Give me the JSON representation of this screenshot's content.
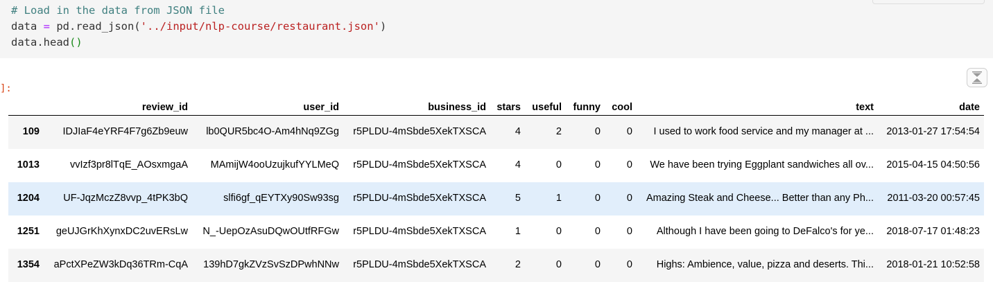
{
  "code": {
    "comment": "# Load in the data from JSON file",
    "line2_var": "data",
    "line2_op": " = ",
    "line2_fn": "pd.read_json(",
    "line2_str": "'../input/nlp-course/restaurant.json'",
    "line2_close": ")",
    "line3_call": "data.head",
    "line3_paren": "()"
  },
  "output": {
    "prompt": "]:",
    "columns": [
      "",
      "review_id",
      "user_id",
      "business_id",
      "stars",
      "useful",
      "funny",
      "cool",
      "text",
      "date"
    ],
    "rows": [
      {
        "index": "109",
        "review_id": "IDJIaF4eYRF4F7g6Zb9euw",
        "user_id": "lb0QUR5bc4O-Am4hNq9ZGg",
        "business_id": "r5PLDU-4mSbde5XekTXSCA",
        "stars": "4",
        "useful": "2",
        "funny": "0",
        "cool": "0",
        "text": "I used to work food service and my manager at ...",
        "date": "2013-01-27 17:54:54"
      },
      {
        "index": "1013",
        "review_id": "vvIzf3pr8lTqE_AOsxmgaA",
        "user_id": "MAmijW4ooUzujkufYYLMeQ",
        "business_id": "r5PLDU-4mSbde5XekTXSCA",
        "stars": "4",
        "useful": "0",
        "funny": "0",
        "cool": "0",
        "text": "We have been trying Eggplant sandwiches all ov...",
        "date": "2015-04-15 04:50:56"
      },
      {
        "index": "1204",
        "review_id": "UF-JqzMczZ8vvp_4tPK3bQ",
        "user_id": "slfi6gf_qEYTXy90Sw93sg",
        "business_id": "r5PLDU-4mSbde5XekTXSCA",
        "stars": "5",
        "useful": "1",
        "funny": "0",
        "cool": "0",
        "text": "Amazing Steak and Cheese... Better than any Ph...",
        "date": "2011-03-20 00:57:45"
      },
      {
        "index": "1251",
        "review_id": "geUJGrKhXynxDC2uvERsLw",
        "user_id": "N_-UepOzAsuDQwOUtfRFGw",
        "business_id": "r5PLDU-4mSbde5XekTXSCA",
        "stars": "1",
        "useful": "0",
        "funny": "0",
        "cool": "0",
        "text": "Although I have been going to DeFalco's for ye...",
        "date": "2018-07-17 01:48:23"
      },
      {
        "index": "1354",
        "review_id": "aPctXPeZW3kDq36TRm-CqA",
        "user_id": "139hD7gkZVzSvSzDPwhNNw",
        "business_id": "r5PLDU-4mSbde5XekTXSCA",
        "stars": "2",
        "useful": "0",
        "funny": "0",
        "cool": "0",
        "text": "Highs: Ambience, value, pizza and deserts. Thi...",
        "date": "2018-01-21 10:52:58"
      }
    ]
  },
  "highlighted_row": 2,
  "icons": {
    "scroll_toggle": "collapse-output-icon"
  }
}
